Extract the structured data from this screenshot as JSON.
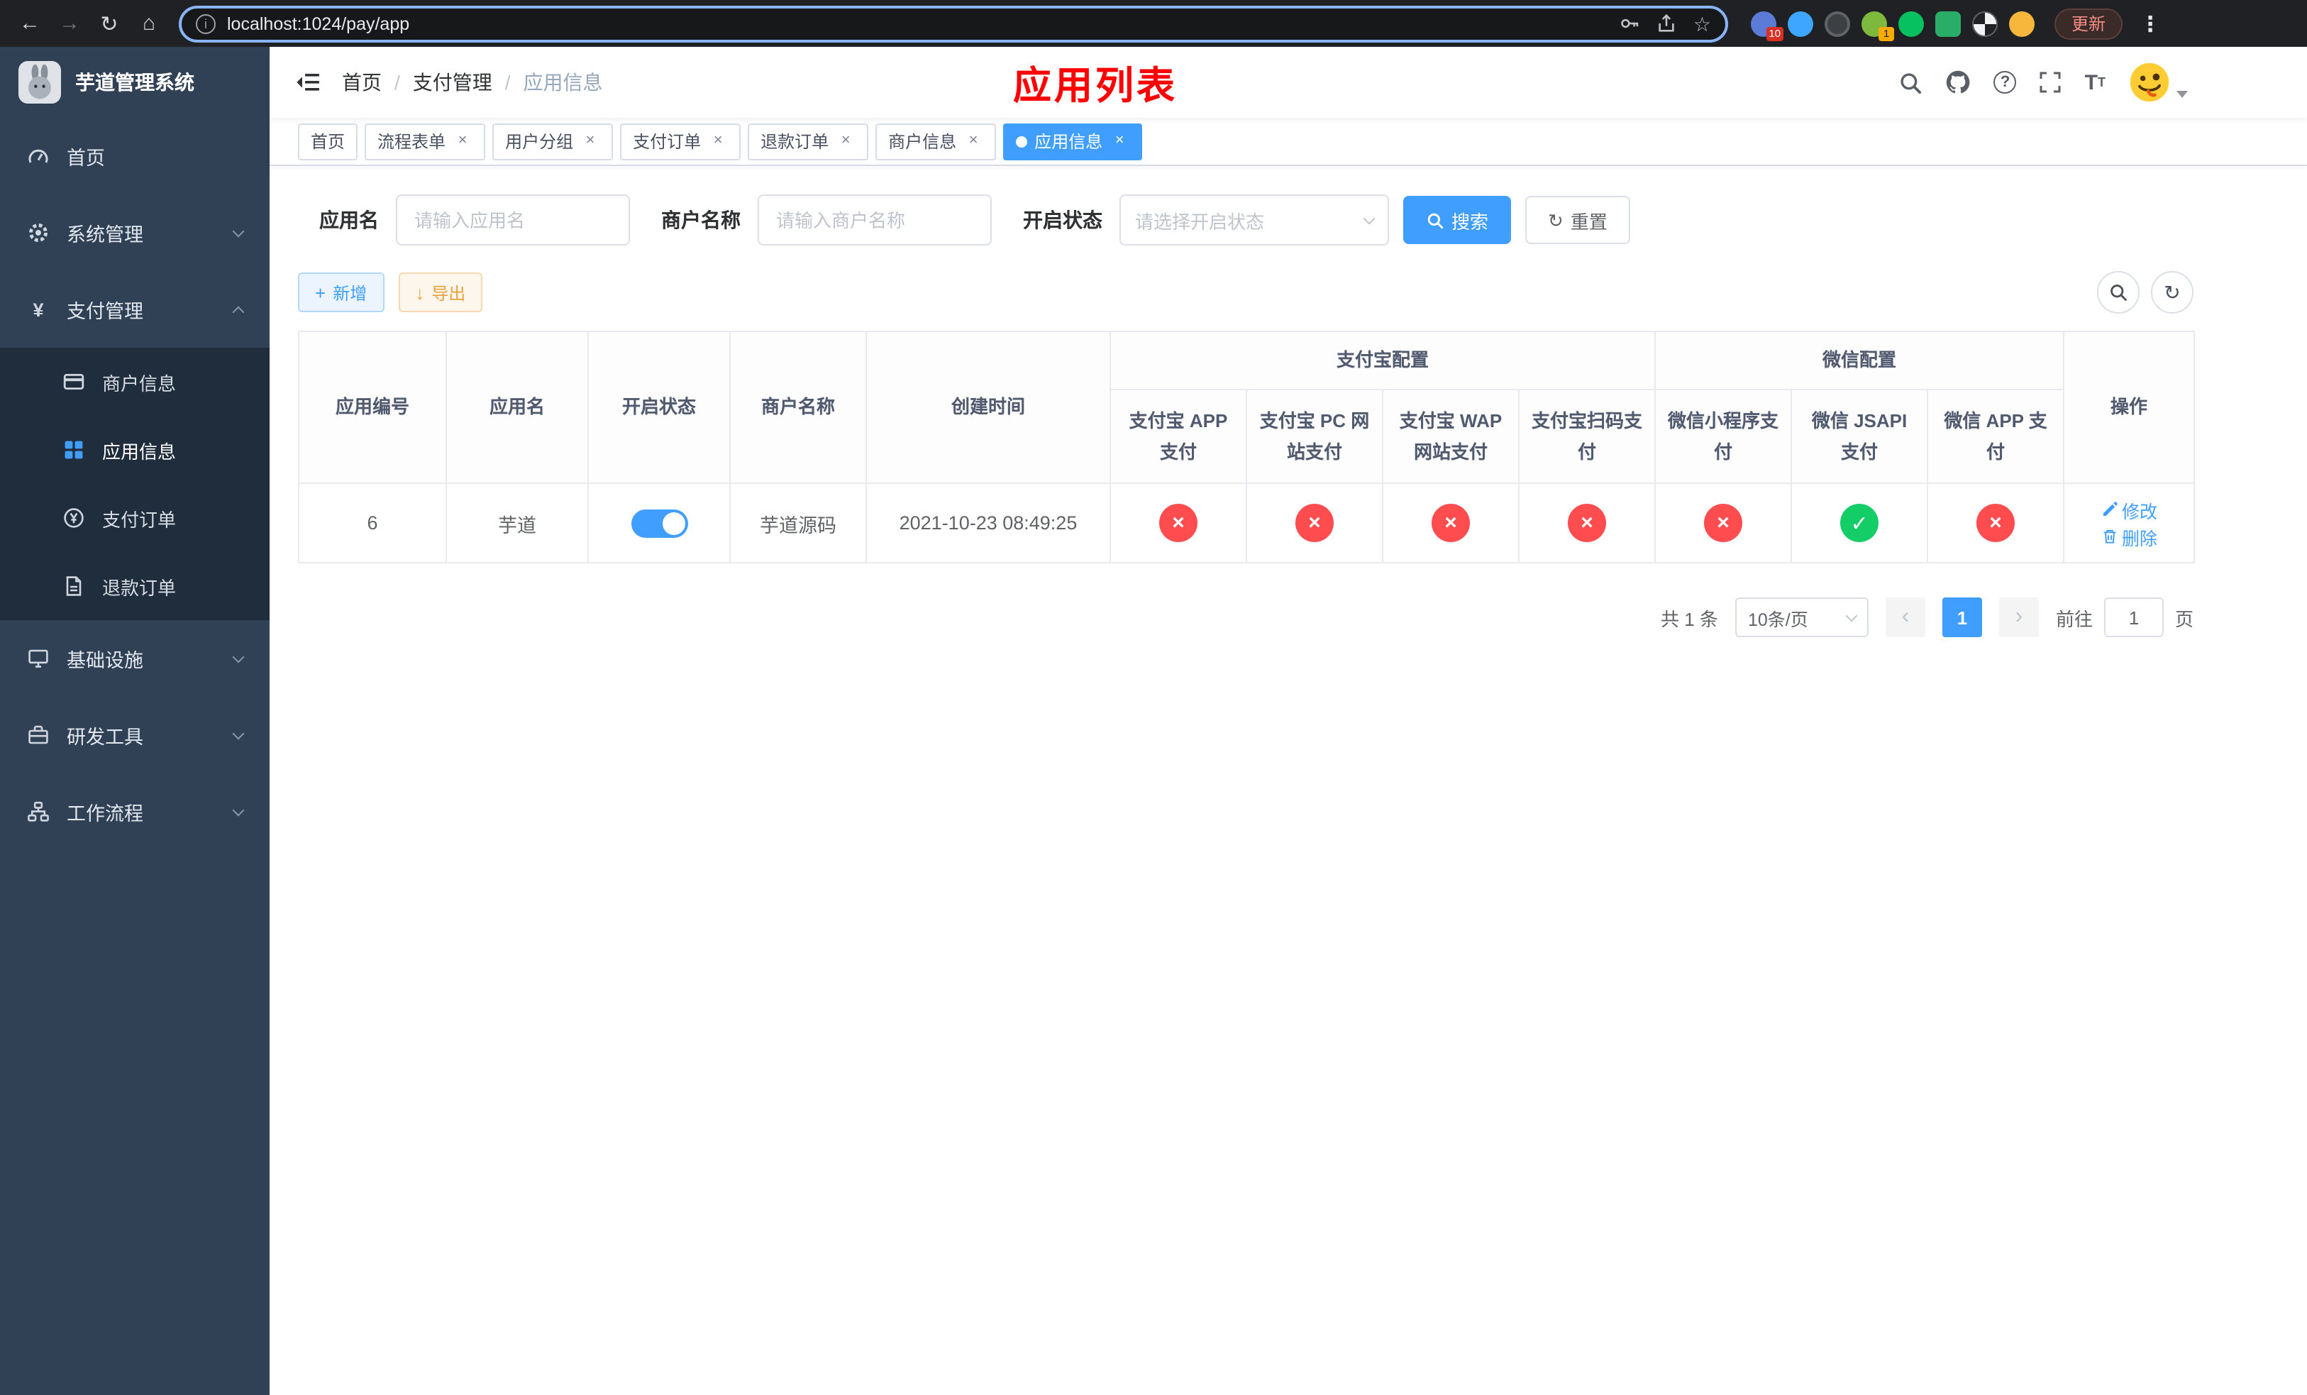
{
  "browser": {
    "url": "localhost:1024/pay/app",
    "update_label": "更新",
    "ext_badge_1": "10",
    "ext_badge_2": "1"
  },
  "icons": {
    "back": "←",
    "forward": "→",
    "reload": "↻",
    "home": "⌂",
    "star": "☆",
    "more": "⋮",
    "info": "i",
    "question": "?",
    "check": "✓",
    "cross": "×",
    "plus": "+",
    "download": "↓",
    "refresh": "↻",
    "close": "×",
    "chevron_left": "‹",
    "chevron_right": "›",
    "font_large": "T",
    "font_small": "T"
  },
  "sidebar": {
    "logo_title": "芋道管理系统",
    "items": {
      "home": "首页",
      "system": "系统管理",
      "payment": "支付管理",
      "infra": "基础设施",
      "devtools": "研发工具",
      "workflow": "工作流程"
    },
    "payment_children": {
      "merchant": "商户信息",
      "app": "应用信息",
      "order": "支付订单",
      "refund": "退款订单"
    }
  },
  "header": {
    "breadcrumb": [
      "首页",
      "支付管理",
      "应用信息"
    ],
    "page_title": "应用列表"
  },
  "tabs": [
    {
      "label": "首页",
      "closable": false,
      "active": false
    },
    {
      "label": "流程表单",
      "closable": true,
      "active": false
    },
    {
      "label": "用户分组",
      "closable": true,
      "active": false
    },
    {
      "label": "支付订单",
      "closable": true,
      "active": false
    },
    {
      "label": "退款订单",
      "closable": true,
      "active": false
    },
    {
      "label": "商户信息",
      "closable": true,
      "active": false
    },
    {
      "label": "应用信息",
      "closable": true,
      "active": true
    }
  ],
  "filters": {
    "app_name_label": "应用名",
    "app_name_placeholder": "请输入应用名",
    "merchant_label": "商户名称",
    "merchant_placeholder": "请输入商户名称",
    "status_label": "开启状态",
    "status_placeholder": "请选择开启状态",
    "search_button": "搜索",
    "reset_button": "重置"
  },
  "toolbar": {
    "add_button": "新增",
    "export_button": "导出"
  },
  "table": {
    "col_id": "应用编号",
    "col_name": "应用名",
    "col_status": "开启状态",
    "col_merchant": "商户名称",
    "col_created": "创建时间",
    "group_alipay": "支付宝配置",
    "group_wechat": "微信配置",
    "alipay_cols": [
      "支付宝 APP 支付",
      "支付宝 PC 网站支付",
      "支付宝 WAP 网站支付",
      "支付宝扫码支付"
    ],
    "wechat_cols": [
      "微信小程序支付",
      "微信 JSAPI 支付",
      "微信 APP 支付"
    ],
    "col_actions": "操作",
    "rows": [
      {
        "id": "6",
        "name": "芋道",
        "enabled": true,
        "merchant": "芋道源码",
        "created": "2021-10-23 08:49:25",
        "statuses": [
          false,
          false,
          false,
          false,
          false,
          true,
          false
        ],
        "edit_label": "修改",
        "delete_label": "删除"
      }
    ]
  },
  "pagination": {
    "total": "共 1 条",
    "page_size": "10条/页",
    "page": "1",
    "goto_label": "前往",
    "goto_value": "1",
    "page_unit": "页"
  }
}
